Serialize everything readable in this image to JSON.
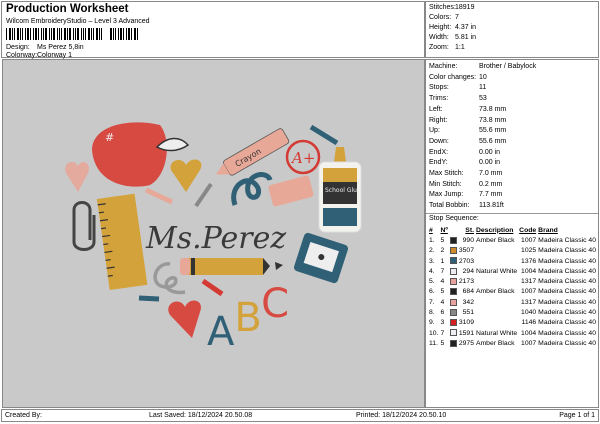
{
  "header": {
    "title": "Production Worksheet",
    "subtitle": "Wilcom EmbroideryStudio – Level 3 Advanced",
    "design_label": "Design:",
    "design_value": "Ms Perez 5,8in",
    "colorway_label": "Colorway:",
    "colorway_value": "Colorway 1"
  },
  "stats": [
    {
      "k": "Stitches:",
      "v": "18919"
    },
    {
      "k": "Colors:",
      "v": "7"
    },
    {
      "k": "Height:",
      "v": "4.37 in"
    },
    {
      "k": "Width:",
      "v": "5.81 in"
    },
    {
      "k": "Zoom:",
      "v": "1:1"
    }
  ],
  "info": [
    {
      "k": "Machine:",
      "v": "Brother / Babylock"
    },
    {
      "k": "Color changes:",
      "v": "10"
    },
    {
      "k": "Stops:",
      "v": "11"
    },
    {
      "k": "Trims:",
      "v": "53"
    },
    {
      "k": "Left:",
      "v": "73.8 mm"
    },
    {
      "k": "Right:",
      "v": "73.8 mm"
    },
    {
      "k": "Up:",
      "v": "55.6 mm"
    },
    {
      "k": "Down:",
      "v": "55.6 mm"
    },
    {
      "k": "EndX:",
      "v": "0.00 in"
    },
    {
      "k": "EndY:",
      "v": "0.00 in"
    },
    {
      "k": "Max Stitch:",
      "v": "7.0 mm"
    },
    {
      "k": "Min Stitch:",
      "v": "0.2 mm"
    },
    {
      "k": "Max Jump:",
      "v": "7.7 mm"
    },
    {
      "k": "Total Bobbin:",
      "v": "113.81ft"
    }
  ],
  "stop_sequence": {
    "title": "Stop Sequence:",
    "headers": [
      "#",
      "Nº",
      "St.",
      "Description",
      "Code",
      "Brand"
    ],
    "rows": [
      {
        "n": "1.",
        "no": "5",
        "color": "#222222",
        "st": "990",
        "desc": "Amber Black",
        "code": "1007",
        "brand": "Madeira Classic 40"
      },
      {
        "n": "2.",
        "no": "2",
        "color": "#d08a2a",
        "st": "3507",
        "desc": "",
        "code": "1025",
        "brand": "Madeira Classic 40"
      },
      {
        "n": "3.",
        "no": "1",
        "color": "#2d5f78",
        "st": "2703",
        "desc": "",
        "code": "1376",
        "brand": "Madeira Classic 40"
      },
      {
        "n": "4.",
        "no": "7",
        "color": "#eeeef2",
        "st": "294",
        "desc": "Natural White",
        "code": "1004",
        "brand": "Madeira Classic 40"
      },
      {
        "n": "5.",
        "no": "4",
        "color": "#e8a3a0",
        "st": "2173",
        "desc": "",
        "code": "1317",
        "brand": "Madeira Classic 40"
      },
      {
        "n": "6.",
        "no": "5",
        "color": "#222222",
        "st": "684",
        "desc": "Amber Black",
        "code": "1007",
        "brand": "Madeira Classic 40"
      },
      {
        "n": "7.",
        "no": "4",
        "color": "#e8a3a0",
        "st": "342",
        "desc": "",
        "code": "1317",
        "brand": "Madeira Classic 40"
      },
      {
        "n": "8.",
        "no": "6",
        "color": "#888888",
        "st": "551",
        "desc": "",
        "code": "1040",
        "brand": "Madeira Classic 40"
      },
      {
        "n": "9.",
        "no": "3",
        "color": "#d42020",
        "st": "3109",
        "desc": "",
        "code": "1146",
        "brand": "Madeira Classic 40"
      },
      {
        "n": "10.",
        "no": "7",
        "color": "#eeeef2",
        "st": "1591",
        "desc": "Natural White",
        "code": "1004",
        "brand": "Madeira Classic 40"
      },
      {
        "n": "11.",
        "no": "5",
        "color": "#222222",
        "st": "2975",
        "desc": "Amber Black",
        "code": "1007",
        "brand": "Madeira Classic 40"
      }
    ]
  },
  "design_artwork": {
    "name": "Ms.Perez",
    "crayon": "Crayon",
    "grade": "A+",
    "glue": "School Glue",
    "letters": "ABC"
  },
  "footer": {
    "created_by": "Created By:",
    "last_saved": "Last Saved: 18/12/2024 20.50.08",
    "printed": "Printed: 18/12/2024 20.50.10",
    "page": "Page 1 of 1"
  }
}
